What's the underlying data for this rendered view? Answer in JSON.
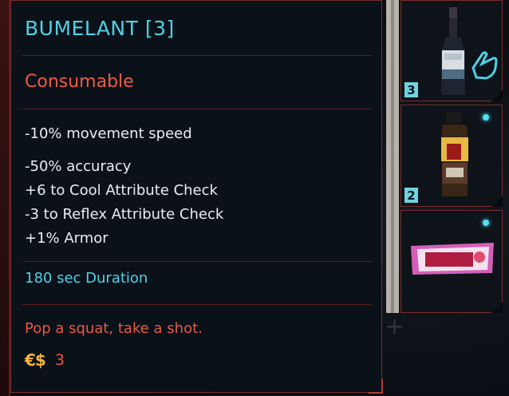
{
  "tooltip": {
    "title": "BUMELANT [3]",
    "type": "Consumable",
    "effects": [
      "-10% movement speed",
      "-50% accuracy",
      "+6 to Cool Attribute Check",
      "-3 to Reflex Attribute Check",
      "+1% Armor"
    ],
    "duration": "180 sec Duration",
    "flavor": "Pop a squat, take a shot.",
    "price_symbol": "€$",
    "price": "3"
  },
  "inventory": {
    "slots": [
      {
        "item_icon": "bottle-icon",
        "count": "3",
        "hovered": true,
        "new": false
      },
      {
        "item_icon": "drink-bottle-icon",
        "count": "2",
        "hovered": false,
        "new": true
      },
      {
        "item_icon": "candy-bar-icon",
        "count": "",
        "hovered": false,
        "new": true
      }
    ]
  },
  "colors": {
    "accent_cyan": "#4fd1e5",
    "accent_red": "#ef5a45",
    "border_red": "#7a2d2a",
    "currency_gold": "#f2b440"
  }
}
